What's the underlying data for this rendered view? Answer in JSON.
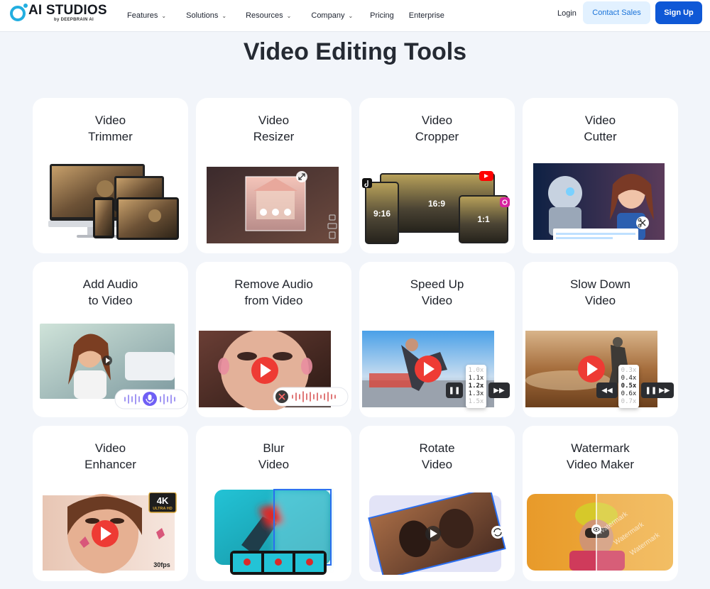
{
  "nav": {
    "logo_main": "AI STUDIOS",
    "logo_sub": "by DEEPBRAIN AI",
    "menu": [
      {
        "label": "Features",
        "has_dropdown": true
      },
      {
        "label": "Solutions",
        "has_dropdown": true
      },
      {
        "label": "Resources",
        "has_dropdown": true
      },
      {
        "label": "Company",
        "has_dropdown": true
      },
      {
        "label": "Pricing",
        "has_dropdown": false
      },
      {
        "label": "Enterprise",
        "has_dropdown": false
      }
    ],
    "login": "Login",
    "contact_sales": "Contact Sales",
    "sign_up": "Sign Up"
  },
  "page": {
    "title": "Video Editing Tools"
  },
  "cards": [
    {
      "title": "Video\nTrimmer"
    },
    {
      "title": "Video\nResizer"
    },
    {
      "title": "Video\nCropper",
      "ratios": [
        "9:16",
        "16:9",
        "1:1"
      ]
    },
    {
      "title": "Video\nCutter"
    },
    {
      "title": "Add Audio\nto Video"
    },
    {
      "title": "Remove Audio\nfrom Video"
    },
    {
      "title": "Speed Up\nVideo",
      "speeds": [
        "1.0x",
        "1.1x",
        "1.2x",
        "1.3x",
        "1.5x"
      ]
    },
    {
      "title": "Slow Down\nVideo",
      "speeds": [
        "0.3x",
        "0.4x",
        "0.5x",
        "0.6x",
        "0.7x"
      ]
    },
    {
      "title": "Video\nEnhancer",
      "badge_main": "4K",
      "badge_sub": "ULTRA HD",
      "fps": "30fps"
    },
    {
      "title": "Blur\nVideo"
    },
    {
      "title": "Rotate\nVideo"
    },
    {
      "title": "Watermark\nVideo Maker",
      "watermark_text": "Watermark"
    }
  ],
  "colors": {
    "brand_blue": "#0f58d6",
    "contact_bg": "#e2f1ff",
    "logo_cyan": "#22aee0",
    "play_red": "#ee3b34",
    "page_bg": "#f2f5fa"
  },
  "icons": {
    "dropdown": "chevron-down-icon",
    "play": "play-icon",
    "mic": "microphone-icon",
    "scissors": "scissors-icon",
    "resize": "resize-arrows-icon",
    "rotate": "rotate-icon",
    "eye": "eye-icon",
    "pause": "pause-icon",
    "fast_forward": "fast-forward-icon",
    "rewind": "rewind-icon"
  }
}
